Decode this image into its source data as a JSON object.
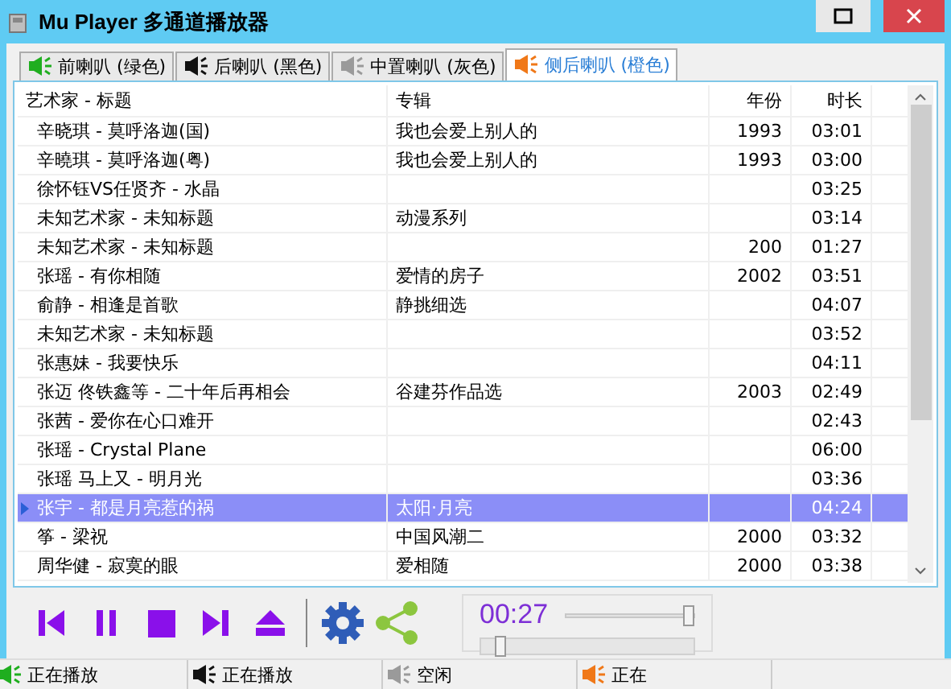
{
  "window": {
    "title": "Mu Player 多通道播放器"
  },
  "tabs": [
    {
      "label": "前喇叭 (绿色)",
      "color": "#1fae1f",
      "selected": false
    },
    {
      "label": "后喇叭 (黑色)",
      "color": "#111111",
      "selected": false
    },
    {
      "label": "中置喇叭 (灰色)",
      "color": "#9a9a9a",
      "selected": false
    },
    {
      "label": "侧后喇叭 (橙色)",
      "color": "#f07818",
      "selected": true
    }
  ],
  "table": {
    "columns": [
      "艺术家 - 标题",
      "专辑",
      "年份",
      "时长"
    ],
    "rows": [
      {
        "title": "辛晓琪 - 莫呼洛迦(国)",
        "album": "我也会爱上别人的",
        "year": "1993",
        "duration": "03:01",
        "selected": false
      },
      {
        "title": "辛曉琪 - 莫呼洛迦(粤)",
        "album": "我也会爱上别人的",
        "year": "1993",
        "duration": "03:00",
        "selected": false
      },
      {
        "title": "徐怀钰VS任贤齐 - 水晶",
        "duration": "03:25",
        "selected": false
      },
      {
        "title": "未知艺术家 - 未知标题",
        "album": "动漫系列",
        "duration": "03:14",
        "selected": false
      },
      {
        "title": "未知艺术家 - 未知标题",
        "year": "200",
        "duration": "01:27",
        "selected": false
      },
      {
        "title": "张瑶 - 有你相随",
        "album": "爱情的房子",
        "year": "2002",
        "duration": "03:51",
        "selected": false
      },
      {
        "title": "俞静 - 相逢是首歌",
        "album": "静挑细选",
        "duration": "04:07",
        "selected": false
      },
      {
        "title": "未知艺术家 - 未知标题",
        "duration": "03:52",
        "selected": false
      },
      {
        "title": "张惠妹 - 我要快乐",
        "duration": "04:11",
        "selected": false
      },
      {
        "title": "张迈 佟铁鑫等 - 二十年后再相会",
        "album": "谷建芬作品选",
        "year": "2003",
        "duration": "02:49",
        "selected": false
      },
      {
        "title": "张茜 - 爱你在心口难开",
        "duration": "02:43",
        "selected": false
      },
      {
        "title": "张瑶 - Crystal Plane",
        "duration": "06:00",
        "selected": false
      },
      {
        "title": "张瑶 马上又 - 明月光",
        "duration": "03:36",
        "selected": false
      },
      {
        "title": "张宇 - 都是月亮惹的祸",
        "album": "太阳·月亮",
        "duration": "04:24",
        "selected": true
      },
      {
        "title": "筝 - 梁祝",
        "album": "中国风潮二",
        "year": "2000",
        "duration": "03:32",
        "selected": false
      },
      {
        "title": "周华健 - 寂寞的眼",
        "album": "爱相随",
        "year": "2000",
        "duration": "03:38",
        "selected": false
      }
    ]
  },
  "player": {
    "time": "00:27",
    "volume": {
      "level": 0.95
    },
    "position": {
      "level": 0.1
    }
  },
  "status_bar": [
    {
      "text": "正在播放",
      "color": "#1fae1f"
    },
    {
      "text": "正在播放",
      "color": "#111111"
    },
    {
      "text": "空闲",
      "color": "#9a9a9a"
    },
    {
      "text": "正在",
      "color": "#f07818"
    }
  ]
}
